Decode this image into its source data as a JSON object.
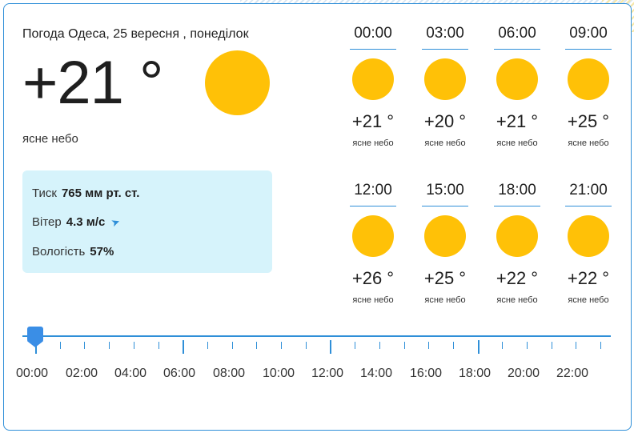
{
  "current": {
    "title": "Погода Одеса, 25 вересня , понеділок",
    "temperature": "+21 °",
    "condition": "ясне небо",
    "icon": "sun-icon"
  },
  "details": {
    "pressure_label": "Тиск",
    "pressure_value": "765 мм рт. ст.",
    "wind_label": "Вітер",
    "wind_value": "4.3 м/с",
    "humidity_label": "Вологість",
    "humidity_value": "57%"
  },
  "forecast": [
    {
      "time": "00:00",
      "temp": "+21 °",
      "desc": "ясне небо"
    },
    {
      "time": "03:00",
      "temp": "+20 °",
      "desc": "ясне небо"
    },
    {
      "time": "06:00",
      "temp": "+21 °",
      "desc": "ясне небо"
    },
    {
      "time": "09:00",
      "temp": "+25 °",
      "desc": "ясне небо"
    },
    {
      "time": "12:00",
      "temp": "+26 °",
      "desc": "ясне небо"
    },
    {
      "time": "15:00",
      "temp": "+25 °",
      "desc": "ясне небо"
    },
    {
      "time": "18:00",
      "temp": "+22 °",
      "desc": "ясне небо"
    },
    {
      "time": "21:00",
      "temp": "+22 °",
      "desc": "ясне небо"
    }
  ],
  "timeline": {
    "labels": [
      "00:00",
      "02:00",
      "04:00",
      "06:00",
      "08:00",
      "10:00",
      "12:00",
      "14:00",
      "16:00",
      "18:00",
      "20:00",
      "22:00"
    ],
    "selected": "00:00"
  },
  "colors": {
    "accent": "#2f8fd8",
    "sun": "#ffc107",
    "info_bg": "#d6f3fb"
  }
}
